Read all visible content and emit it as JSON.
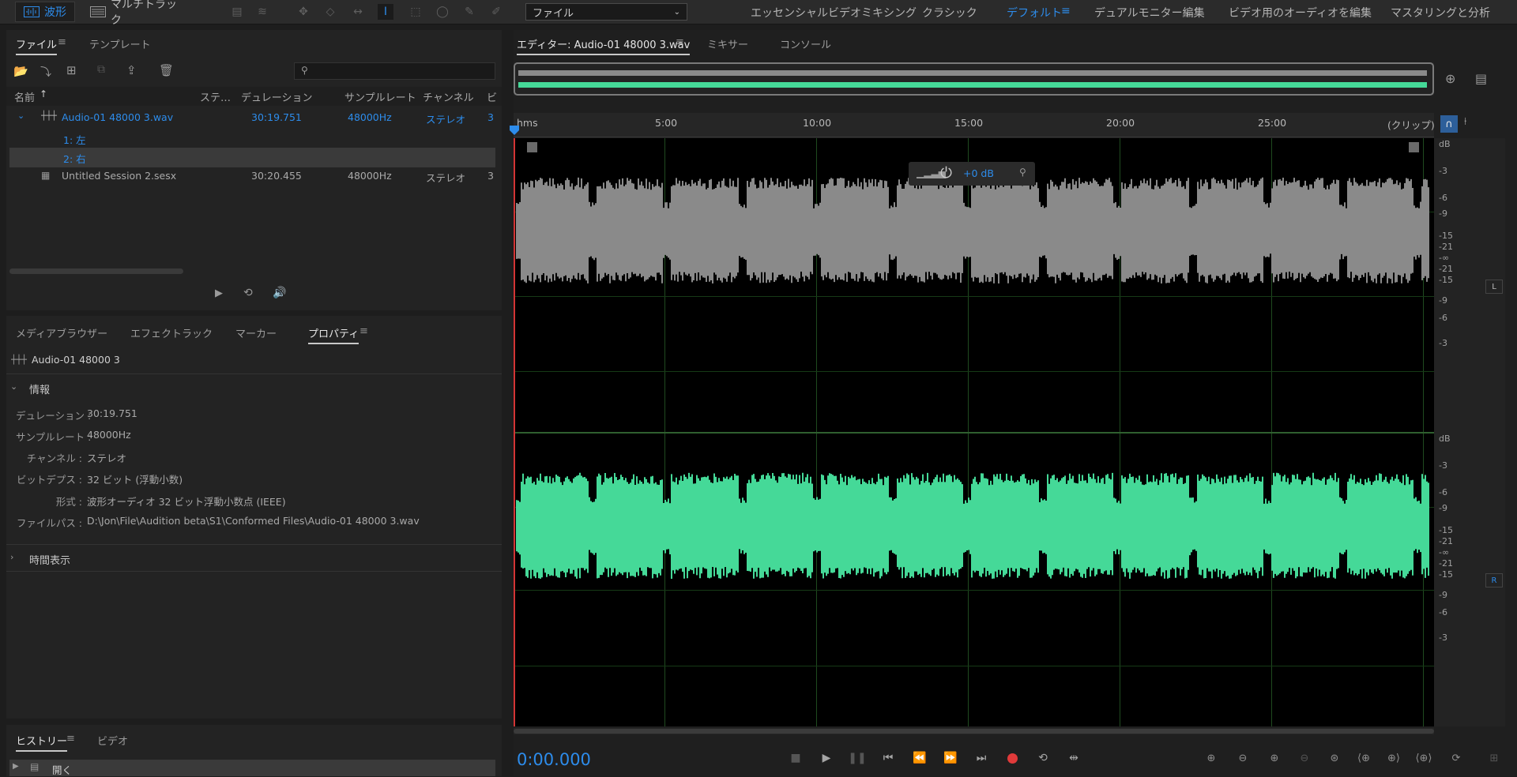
{
  "toolbar": {
    "waveform_label": "波形",
    "multitrack_label": "マルチトラック",
    "workspace_select": "ファイル",
    "workspaces": [
      "エッセンシャルビデオミキシング",
      "クラシック",
      "デフォルト",
      "デュアルモニター編集",
      "ビデオ用のオーディオを編集",
      "マスタリングと分析"
    ]
  },
  "files_panel": {
    "tabs": [
      "ファイル",
      "テンプレート"
    ],
    "columns": [
      "名前",
      "ステ…",
      "デュレーション",
      "サンプルレート",
      "チャンネル",
      "ビ"
    ],
    "rows": [
      {
        "name": "Audio-01 48000 3.wav",
        "duration": "30:19.751",
        "rate": "48000Hz",
        "channel": "ステレオ",
        "bit": "3"
      },
      {
        "name": "1: 左"
      },
      {
        "name": "2: 右"
      },
      {
        "name": "Untitled Session 2.sesx",
        "duration": "30:20.455",
        "rate": "48000Hz",
        "channel": "ステレオ",
        "bit": "3"
      }
    ]
  },
  "lower_left": {
    "tabs": [
      "メディアブラウザー",
      "エフェクトラック",
      "マーカー",
      "プロパティ"
    ],
    "file_title": "Audio-01 48000 3",
    "section_info": "情報",
    "section_time": "時間表示",
    "props": [
      {
        "label": "デュレーション :",
        "value": "30:19.751"
      },
      {
        "label": "サンプルレート :",
        "value": "48000Hz"
      },
      {
        "label": "チャンネル :",
        "value": "ステレオ"
      },
      {
        "label": "ビットデプス :",
        "value": "32 ビット (浮動小数)"
      },
      {
        "label": "形式 :",
        "value": "波形オーディオ 32 ビット浮動小数点 (IEEE)"
      },
      {
        "label": "ファイルパス :",
        "value": "D:\\Jon\\File\\Audition beta\\S1\\Conformed Files\\Audio-01 48000 3.wav"
      }
    ]
  },
  "history": {
    "tabs": [
      "ヒストリー",
      "ビデオ"
    ],
    "item": "開く"
  },
  "editor": {
    "tabs": [
      "エディター: Audio-01 48000 3.wav",
      "ミキサー",
      "コンソール"
    ],
    "ruler": [
      "hms",
      "5:00",
      "10:00",
      "15:00",
      "20:00",
      "25:00",
      "(クリップ)"
    ],
    "hud_gain": "+0 dB",
    "db_top": [
      "dB",
      "-3",
      "-6",
      "-9",
      "-15",
      "-21",
      "-∞",
      "-21",
      "-15",
      "-9",
      "-6",
      "-3"
    ],
    "db_bottom": [
      "dB",
      "-3",
      "-6",
      "-9",
      "-15",
      "-21",
      "-∞",
      "-21",
      "-15",
      "-9",
      "-6",
      "-3"
    ],
    "channel_top": "L",
    "channel_bottom": "R",
    "time": "0:00.000",
    "colors": {
      "left_wave": "#8a8a8a",
      "right_wave": "#45d998",
      "accent": "#2d8ceb",
      "record": "#e03a3a"
    }
  }
}
